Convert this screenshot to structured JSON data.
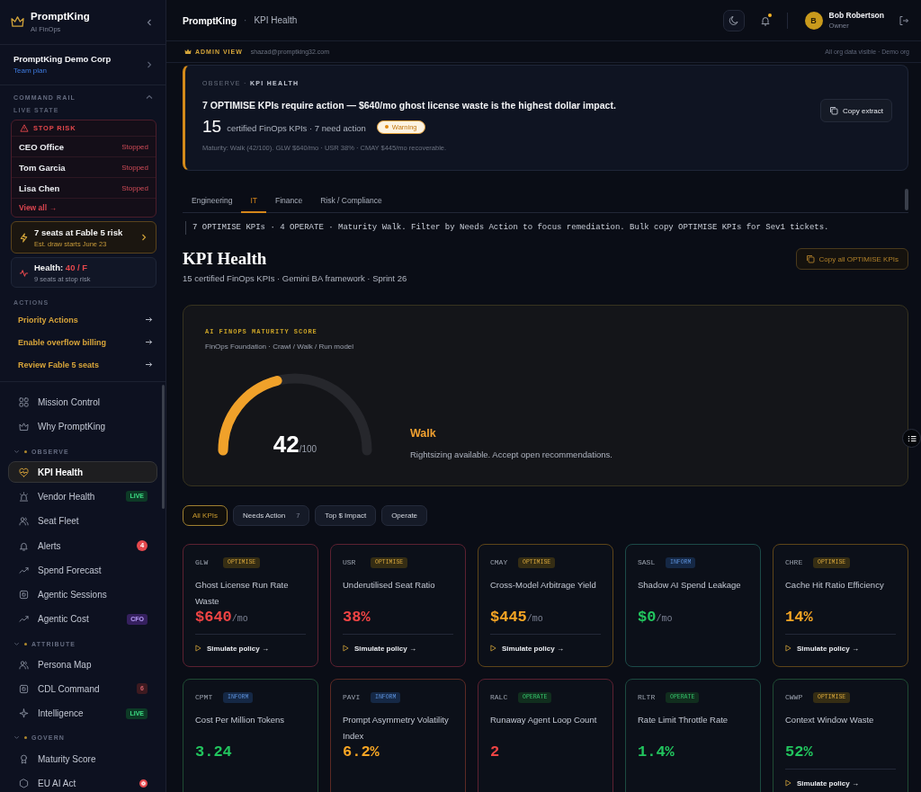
{
  "sidebar": {
    "brand": {
      "name": "PromptKing",
      "tagline": "AI FinOps"
    },
    "org": {
      "name": "PromptKing Demo Corp",
      "plan": "Team plan"
    },
    "command_rail": {
      "title": "COMMAND RAIL",
      "expanded": true,
      "subtitle": "LIVE STATE"
    },
    "stop_risk": {
      "title": "STOP RISK",
      "rows": [
        {
          "name": "CEO Office",
          "status": "Stopped"
        },
        {
          "name": "Tom Garcia",
          "status": "Stopped"
        },
        {
          "name": "Lisa Chen",
          "status": "Stopped"
        }
      ],
      "link": "View all →"
    },
    "fable_alert": {
      "title": "7 seats at Fable 5 risk",
      "subtitle": "Est. draw starts June 23"
    },
    "health": {
      "label": "Health:",
      "value": "40 / F",
      "subtitle": "9 seats at stop risk"
    },
    "actions": {
      "title": "ACTIONS",
      "items": [
        "Priority Actions",
        "Enable overflow billing",
        "Review Fable 5 seats"
      ]
    },
    "nav": [
      {
        "kind": "link",
        "label": "Mission Control",
        "selected": false
      },
      {
        "kind": "link",
        "label": "Why PromptKing",
        "selected": false
      },
      {
        "kind": "section",
        "label": "OBSERVE",
        "expanded": true,
        "children": [
          {
            "kind": "link",
            "label": "KPI Health",
            "selected": true
          },
          {
            "kind": "link",
            "label": "Vendor Health",
            "selected": false,
            "badge": {
              "kind": "live",
              "text": "LIVE"
            }
          },
          {
            "kind": "link",
            "label": "Seat Fleet",
            "selected": false
          },
          {
            "kind": "link",
            "label": "Alerts",
            "selected": false,
            "badge": {
              "kind": "count",
              "text": "4"
            }
          },
          {
            "kind": "link",
            "label": "Spend Forecast",
            "selected": false
          },
          {
            "kind": "link",
            "label": "Agentic Sessions",
            "selected": false
          },
          {
            "kind": "link",
            "label": "Agentic Cost",
            "selected": false,
            "badge": {
              "kind": "role",
              "text": "CFO"
            }
          }
        ]
      },
      {
        "kind": "section",
        "label": "ATTRIBUTE",
        "expanded": true,
        "children": [
          {
            "kind": "link",
            "label": "Persona Map",
            "selected": false
          },
          {
            "kind": "link",
            "label": "CDL Command",
            "selected": false,
            "badge": {
              "kind": "muted",
              "text": "6"
            }
          },
          {
            "kind": "link",
            "label": "Intelligence",
            "selected": false,
            "badge": {
              "kind": "live",
              "text": "LIVE"
            }
          }
        ]
      },
      {
        "kind": "section",
        "label": "GOVERN",
        "expanded": true,
        "children": [
          {
            "kind": "link",
            "label": "Maturity Score",
            "selected": false
          },
          {
            "kind": "link",
            "label": "EU AI Act",
            "selected": false,
            "badge": {
              "kind": "dot"
            }
          }
        ]
      }
    ]
  },
  "header": {
    "app": "PromptKing",
    "separator": "·",
    "page": "KPI Health",
    "unread_notifications": true,
    "user": {
      "initial": "B",
      "name": "Bob Robertson",
      "role": "Owner"
    }
  },
  "admin_bar": {
    "label": "ADMIN VIEW",
    "email": "shazad@promptking32.com",
    "note": "All org data visible · Demo org"
  },
  "banner": {
    "eyebrow": "OBSERVE · **KPI HEALTH**",
    "headline": "7 OPTIMISE KPIs require action — $640/mo ghost license waste is the highest dollar impact.",
    "count": "15",
    "count_label": "certified FinOps KPIs · 7 need action",
    "status": {
      "kind": "warning",
      "text": "Warning"
    },
    "summary": "Maturity: Walk (42/100). GLW $640/mo · USR 38% · CMAY $445/mo recoverable.",
    "copy_button": "Copy extract"
  },
  "tabs": [
    {
      "label": "Engineering",
      "selected": false
    },
    {
      "label": "IT",
      "selected": true
    },
    {
      "label": "Finance",
      "selected": false
    },
    {
      "label": "Risk / Compliance",
      "selected": false
    }
  ],
  "explainer": "7 OPTIMISE KPIs · 4 OPERATE · Maturity Walk. Filter by Needs Action to focus remediation. Bulk copy OPTIMISE KPIs for Sev1 tickets.",
  "page_title": {
    "title": "KPI Health",
    "subtitle": "15 certified FinOps KPIs · Gemini BA framework · Sprint 26",
    "copy_all_button": "Copy all OPTIMISE KPIs"
  },
  "maturity": {
    "eyebrow": "AI FINOPS MATURITY SCORE",
    "subtitle": "FinOps Foundation · Crawl / Walk / Run model",
    "score": "42",
    "max": "/100",
    "level": 0.42,
    "stage": "Walk",
    "description": "Rightsizing available. Accept open recommendations."
  },
  "filters": [
    {
      "label": "All KPIs",
      "selected": true
    },
    {
      "label": "Needs Action",
      "count": "7",
      "selected": false
    },
    {
      "label": "Top $ Impact",
      "selected": false
    },
    {
      "label": "Operate",
      "selected": false
    }
  ],
  "kpis": [
    {
      "code": "GLW",
      "badge": {
        "kind": "optimise",
        "text": "OPTIMISE"
      },
      "name": "Ghost License Run Rate Waste",
      "value": {
        "text": "$640",
        "color": "#ef4444"
      },
      "unit": "/mo",
      "color": "#5c2131",
      "action": "Simulate policy →"
    },
    {
      "code": "USR",
      "badge": {
        "kind": "optimise",
        "text": "OPTIMISE"
      },
      "name": "Underutilised Seat Ratio",
      "value": {
        "text": "38%",
        "color": "#ef4444"
      },
      "color": "#5c2131",
      "action": "Simulate policy →"
    },
    {
      "code": "CMAY",
      "badge": {
        "kind": "optimise",
        "text": "OPTIMISE"
      },
      "name": "Cross-Model Arbitrage Yield",
      "value": {
        "text": "$445",
        "color": "#f5a524"
      },
      "unit": "/mo",
      "color": "#5e4519",
      "action": "Simulate policy →"
    },
    {
      "code": "SASL",
      "badge": {
        "kind": "inform",
        "text": "INFORM"
      },
      "name": "Shadow AI Spend Leakage",
      "value": {
        "text": "$0",
        "color": "#22c55e"
      },
      "unit": "/mo",
      "color": "#1c4a48"
    },
    {
      "code": "CHRE",
      "badge": {
        "kind": "optimise",
        "text": "OPTIMISE"
      },
      "name": "Cache Hit Ratio Efficiency",
      "value": {
        "text": "14%",
        "color": "#f5a524"
      },
      "color": "#5e4519",
      "action": "Simulate policy →"
    },
    {
      "code": "CPMT",
      "badge": {
        "kind": "inform",
        "text": "INFORM"
      },
      "name": "Cost Per Million Tokens",
      "value": {
        "text": "3.24",
        "color": "#22c55e"
      },
      "color": "#1f4a33"
    },
    {
      "code": "PAVI",
      "badge": {
        "kind": "inform",
        "text": "INFORM"
      },
      "name": "Prompt Asymmetry Volatility Index",
      "value": {
        "text": "6.2%",
        "color": "#f5a524"
      },
      "color": "#5c2a24"
    },
    {
      "code": "RALC",
      "badge": {
        "kind": "operate",
        "text": "OPERATE"
      },
      "name": "Runaway Agent Loop Count",
      "value": {
        "text": "2",
        "color": "#ef4444"
      },
      "color": "#5c2131"
    },
    {
      "code": "RLTR",
      "badge": {
        "kind": "operate",
        "text": "OPERATE"
      },
      "name": "Rate Limit Throttle Rate",
      "value": {
        "text": "1.4%",
        "color": "#22c55e"
      },
      "color": "#1c4a40"
    },
    {
      "code": "CWWP",
      "badge": {
        "kind": "optimise",
        "text": "OPTIMISE"
      },
      "name": "Context Window Waste",
      "value": {
        "text": "52%",
        "color": "#22c55e"
      },
      "color": "#1f4a33",
      "action": "Simulate policy →"
    }
  ]
}
